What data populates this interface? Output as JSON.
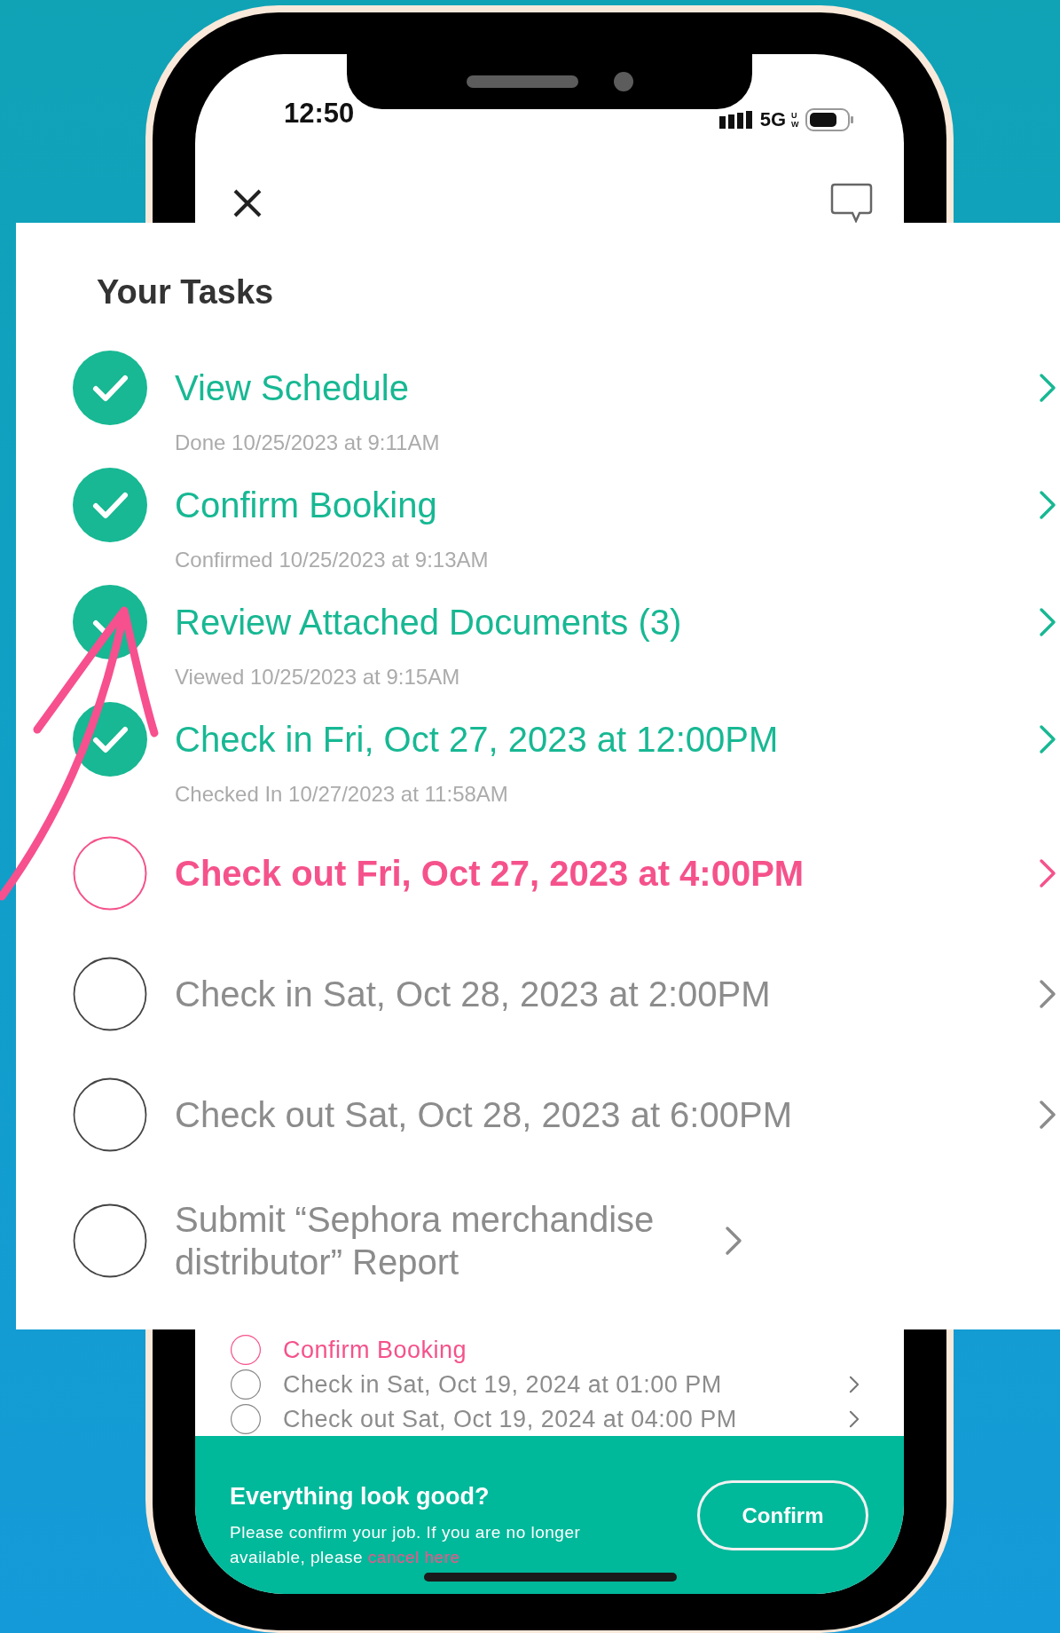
{
  "status_bar": {
    "time": "12:50",
    "network": "5G",
    "network_badge": "UW"
  },
  "card": {
    "title": "Your Tasks",
    "tasks": [
      {
        "title": "View Schedule",
        "subtitle": "Done 10/25/2023 at 9:11AM",
        "checked": true,
        "selected": false
      },
      {
        "title": "Confirm Booking",
        "subtitle": "Confirmed 10/25/2023 at 9:13AM",
        "checked": true,
        "selected": false
      },
      {
        "title": "Review Attached Documents (3)",
        "subtitle": "Viewed 10/25/2023 at 9:15AM",
        "checked": true,
        "selected": false
      },
      {
        "title": "Check in Fri, Oct 27, 2023 at 12:00PM",
        "subtitle": "Checked In 10/27/2023 at 11:58AM",
        "checked": true,
        "selected": false
      },
      {
        "title": "Check out Fri, Oct 27, 2023 at 4:00PM",
        "checked": false,
        "selected": true
      },
      {
        "title": "Check in Sat, Oct 28, 2023 at 2:00PM",
        "checked": false,
        "selected": false
      },
      {
        "title": "Check out Sat, Oct 28, 2023 at 6:00PM",
        "checked": false,
        "selected": false
      },
      {
        "title": "Submit “Sephora merchandise distributor” Report",
        "checked": false,
        "selected": false
      }
    ]
  },
  "phone_tasks": [
    {
      "title": "Confirm Booking",
      "checked": false,
      "selected": true
    },
    {
      "title": "Check in Sat, Oct 19, 2024 at 01:00 PM",
      "checked": false,
      "selected": false
    },
    {
      "title": "Check out Sat, Oct 19, 2024 at 04:00 PM",
      "checked": false,
      "selected": false
    }
  ],
  "footer": {
    "heading": "Everything look good?",
    "text": "Please confirm your job. If you are no longer available, please",
    "link": "cancel here",
    "button": "Confirm"
  }
}
